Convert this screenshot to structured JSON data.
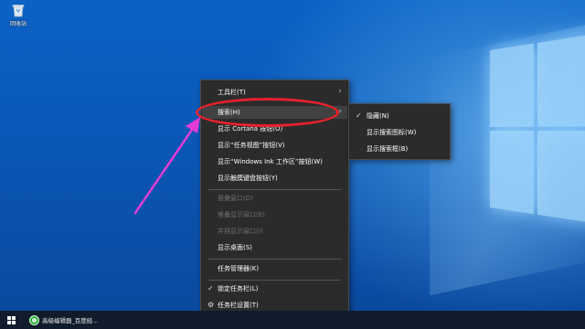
{
  "desktop": {
    "icon_label": "回收站"
  },
  "context_menu": {
    "items": [
      {
        "label": "工具栏(T)",
        "state": "normal",
        "submenu": true
      },
      {
        "label": "搜索(H)",
        "state": "highlighted",
        "submenu": true
      },
      {
        "label": "显示 Cortana 按钮(O)",
        "state": "normal"
      },
      {
        "label": "显示“任务视图”按钮(V)",
        "state": "normal"
      },
      {
        "label": "显示“Windows Ink 工作区”按钮(W)",
        "state": "normal"
      },
      {
        "label": "显示触摸键盘按钮(Y)",
        "state": "normal"
      },
      {
        "label": "层叠窗口(D)",
        "state": "disabled"
      },
      {
        "label": "堆叠显示窗口(E)",
        "state": "disabled"
      },
      {
        "label": "并排显示窗口(I)",
        "state": "disabled"
      },
      {
        "label": "显示桌面(S)",
        "state": "normal"
      },
      {
        "label": "任务管理器(K)",
        "state": "normal"
      },
      {
        "label": "锁定任务栏(L)",
        "state": "checked"
      },
      {
        "label": "任务栏设置(T)",
        "state": "normal",
        "icon": "gear-icon"
      }
    ]
  },
  "search_submenu": {
    "items": [
      {
        "label": "隐藏(N)",
        "checked": true
      },
      {
        "label": "显示搜索图标(W)",
        "checked": false
      },
      {
        "label": "显示搜索框(B)",
        "checked": false
      }
    ]
  },
  "taskbar": {
    "running_app": "高级编辑器_百度经..."
  },
  "glyphs": {
    "submenu_arrow": "›",
    "check": "✓",
    "gear": "⚙"
  },
  "annotation": {
    "highlight_color": "#e8212d",
    "arrow_color": "#e23bd6"
  }
}
